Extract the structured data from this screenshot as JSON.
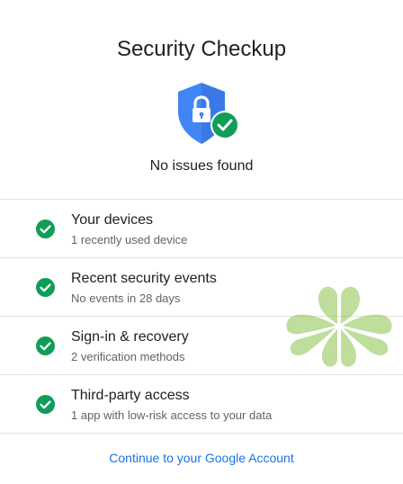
{
  "header": {
    "title": "Security Checkup",
    "status_text": "No issues found",
    "shield_icon": "shield-lock-icon",
    "shield_color": "#4285f4",
    "badge_color": "#0f9d58"
  },
  "items": [
    {
      "title": "Your devices",
      "subtitle": "1 recently used device",
      "icon": "check-circle-icon"
    },
    {
      "title": "Recent security events",
      "subtitle": "No events in 28 days",
      "icon": "check-circle-icon"
    },
    {
      "title": "Sign-in & recovery",
      "subtitle": "2 verification methods",
      "icon": "check-circle-icon"
    },
    {
      "title": "Third-party access",
      "subtitle": "1 app with low-risk access to your data",
      "icon": "check-circle-icon"
    }
  ],
  "footer": {
    "link_label": "Continue to your Google Account",
    "link_color": "#1a73e8"
  },
  "colors": {
    "check": "#0f9d58",
    "watermark": "#8bc34a"
  }
}
